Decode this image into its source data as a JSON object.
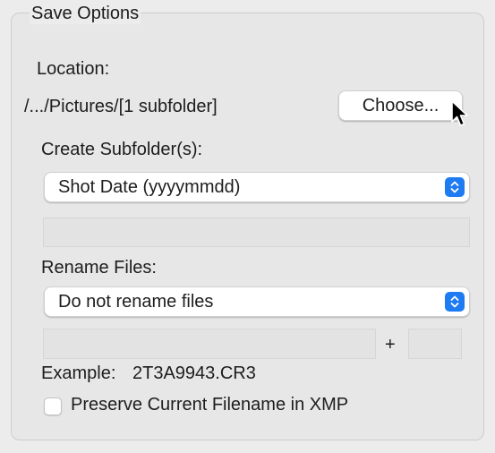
{
  "panel": {
    "title": "Save Options"
  },
  "location": {
    "label": "Location:",
    "path": "/.../Pictures/[1 subfolder]",
    "choose_label": "Choose..."
  },
  "subfolder": {
    "label": "Create Subfolder(s):",
    "selected": "Shot Date (yyyymmdd)",
    "custom_value": ""
  },
  "rename": {
    "label": "Rename Files:",
    "selected": "Do not rename files",
    "name_value": "",
    "plus": "+",
    "suffix_value": ""
  },
  "example": {
    "label": "Example:",
    "filename": "2T3A9943.CR3"
  },
  "preserve": {
    "label": "Preserve Current Filename in XMP",
    "checked": false
  },
  "colors": {
    "accent": "#1f7bf2",
    "panel_background": "#e7e7e7"
  },
  "icons": {
    "popup_stepper": "chevron-up-down-icon",
    "cursor": "arrow-pointer-icon"
  }
}
